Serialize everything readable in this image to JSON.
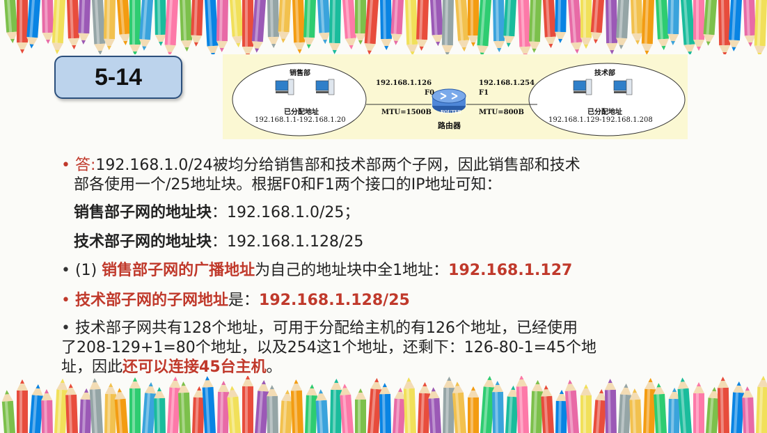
{
  "slide_number": "5-14",
  "diagram": {
    "left_group": {
      "name": "销售部",
      "allocated_label": "已分配地址",
      "range": "192.168.1.1-192.168.1.20"
    },
    "right_group": {
      "name": "技术部",
      "allocated_label": "已分配地址",
      "range": "192.168.1.129-192.168.1.208"
    },
    "router": {
      "name": "路由器",
      "badge": "ROUTER",
      "f0_ip": "192.168.1.126",
      "f0_label": "F0",
      "f0_mtu": "MTU=1500B",
      "f1_ip": "192.168.1.254",
      "f1_label": "F1",
      "f1_mtu": "MTU=800B"
    }
  },
  "content": {
    "bullet": "•",
    "answer_prefix": "答:",
    "answer_line1": "192.168.1.0/24被均分给销售部和技术部两个子网，因此销售部和技术",
    "answer_line2": "部各使用一个/25地址块。根据F0和F1两个接口的IP地址可知：",
    "sales_block_label": "销售部子网的地址块",
    "sales_block_value": "：192.168.1.0/25；",
    "tech_block_label": "技术部子网的地址块",
    "tech_block_value": "：192.168.1.128/25",
    "q1_prefix": "(1) ",
    "q1_label": "销售部子网的广播地址",
    "q1_mid": "为自己的地址块中全1地址：",
    "q1_value": "192.168.1.127",
    "q2_label": "技术部子网的子网地址",
    "q2_mid": "是：",
    "q2_value": "192.168.1.128/25",
    "q3_line1": "技术部子网共有128个地址，可用于分配给主机的有126个地址，已经使用",
    "q3_line2": "了208-129+1=80个地址，以及254这1个地址，还剩下：126-80-1=45个地",
    "q3_line3_a": "址，因此",
    "q3_line3_b": "还可以连接45台主机",
    "q3_line3_c": "。"
  }
}
